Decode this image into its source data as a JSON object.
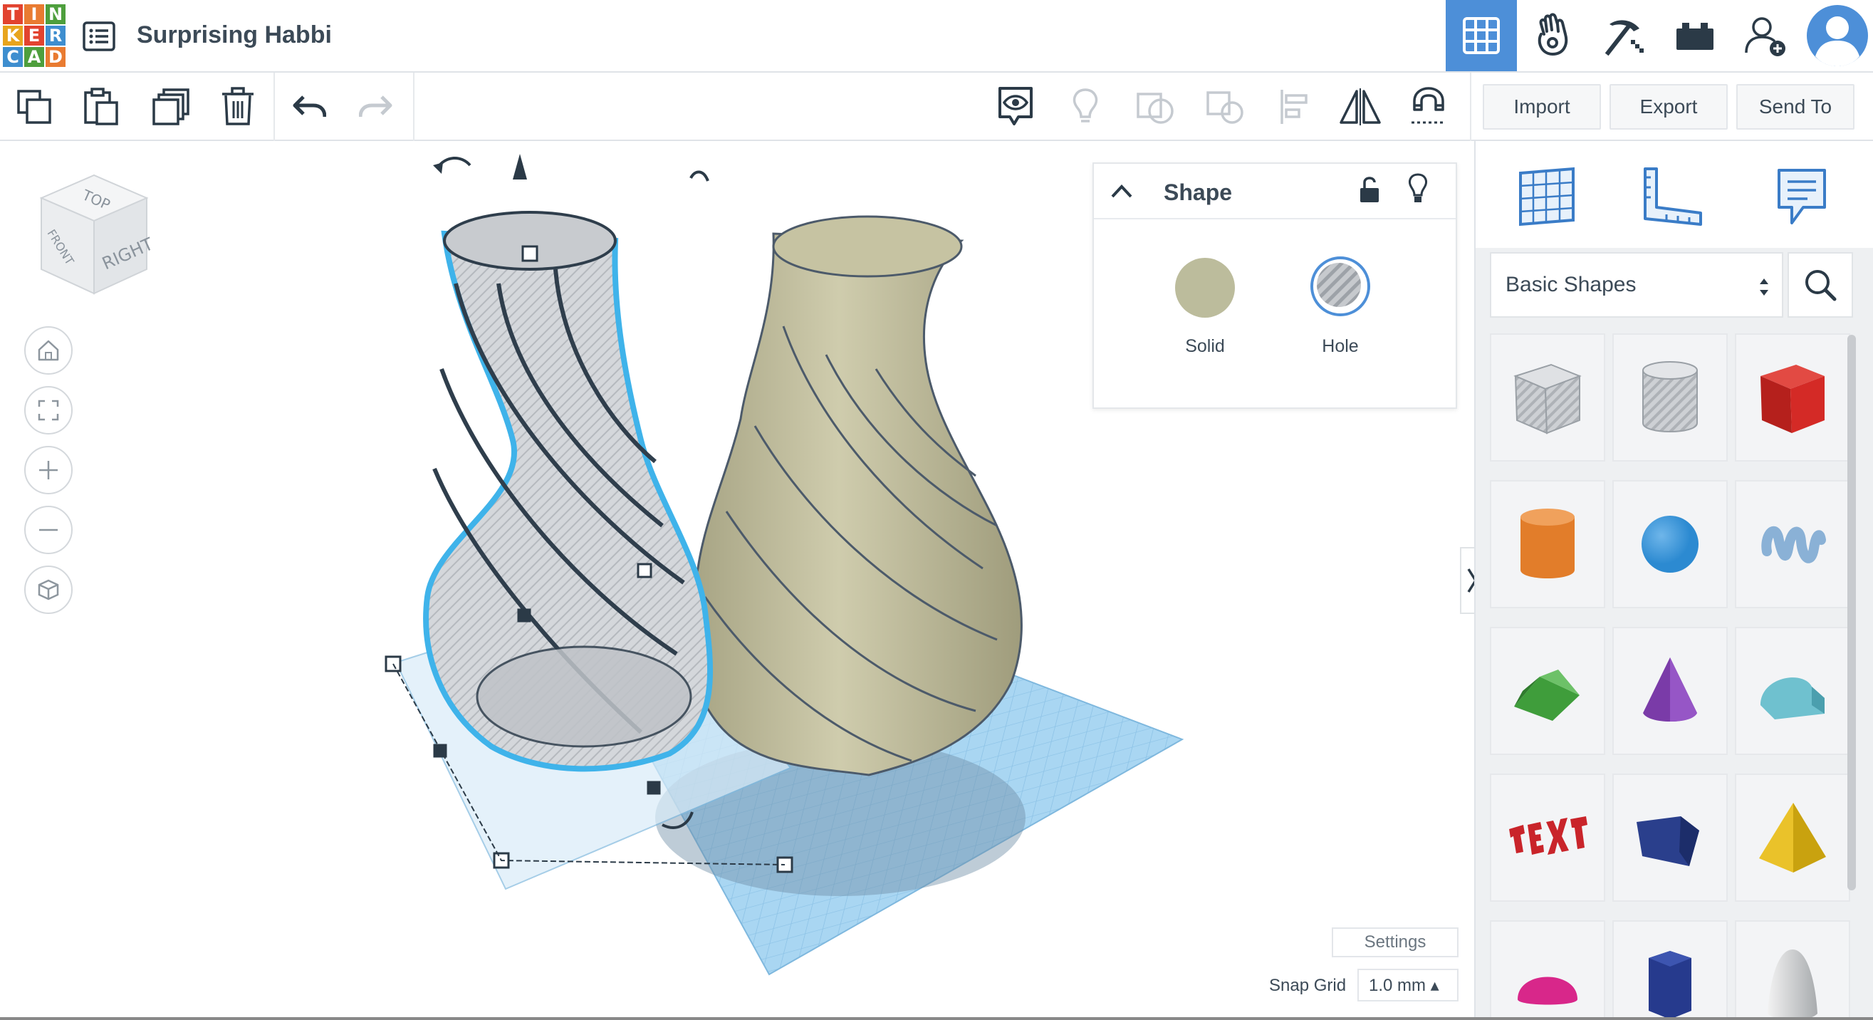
{
  "app": {
    "logo_letters": [
      "T",
      "I",
      "N",
      "K",
      "E",
      "R",
      "C",
      "A",
      "D"
    ],
    "logo_colors": [
      "#e2432f",
      "#e97b31",
      "#4e9f3d",
      "#e8a41d",
      "#e2432f",
      "#3e8ecf",
      "#3e8ecf",
      "#4e9f3d",
      "#e97b31"
    ],
    "title": "Surprising Habbi",
    "accent": "#4d8fd8"
  },
  "topbar": {
    "buttons": [
      {
        "name": "3d-design-grid-icon",
        "active": true
      },
      {
        "name": "circuits-hand-icon"
      },
      {
        "name": "codeblocks-pickaxe-icon"
      },
      {
        "name": "bricks-icon"
      },
      {
        "name": "add-user-icon"
      },
      {
        "name": "avatar-icon"
      }
    ]
  },
  "toolbar": {
    "import_label": "Import",
    "export_label": "Export",
    "send_to_label": "Send To"
  },
  "shape_panel": {
    "title": "Shape",
    "solid_label": "Solid",
    "hole_label": "Hole",
    "solid_color": "#bcbc9c",
    "selected": "Hole"
  },
  "viewcube": {
    "top": "TOP",
    "front": "FRONT",
    "right": "RIGHT"
  },
  "footer": {
    "settings_label": "Settings",
    "snap_grid_label": "Snap Grid",
    "snap_grid_value": "1.0 mm ▴"
  },
  "library": {
    "selected": "Basic Shapes",
    "shapes": [
      {
        "name": "box-hole",
        "color": "#bfc3c8"
      },
      {
        "name": "cylinder-hole",
        "color": "#c8ccd0"
      },
      {
        "name": "box",
        "color": "#d42a26"
      },
      {
        "name": "cylinder",
        "color": "#e27d2a"
      },
      {
        "name": "sphere",
        "color": "#2c8ad1"
      },
      {
        "name": "scribble",
        "color": "#8ab1d6"
      },
      {
        "name": "roof",
        "color": "#3f9d3b"
      },
      {
        "name": "cone",
        "color": "#7a3ba8"
      },
      {
        "name": "round-roof",
        "color": "#6fc1cf"
      },
      {
        "name": "text",
        "color": "#c9242a"
      },
      {
        "name": "polygon",
        "color": "#2a3f8c"
      },
      {
        "name": "pyramid",
        "color": "#eac22a"
      },
      {
        "name": "half-sphere",
        "color": "#d8278a"
      },
      {
        "name": "hexagonal-prism",
        "color": "#263a8d"
      },
      {
        "name": "paraboloid",
        "color": "#d9dadb"
      }
    ]
  }
}
